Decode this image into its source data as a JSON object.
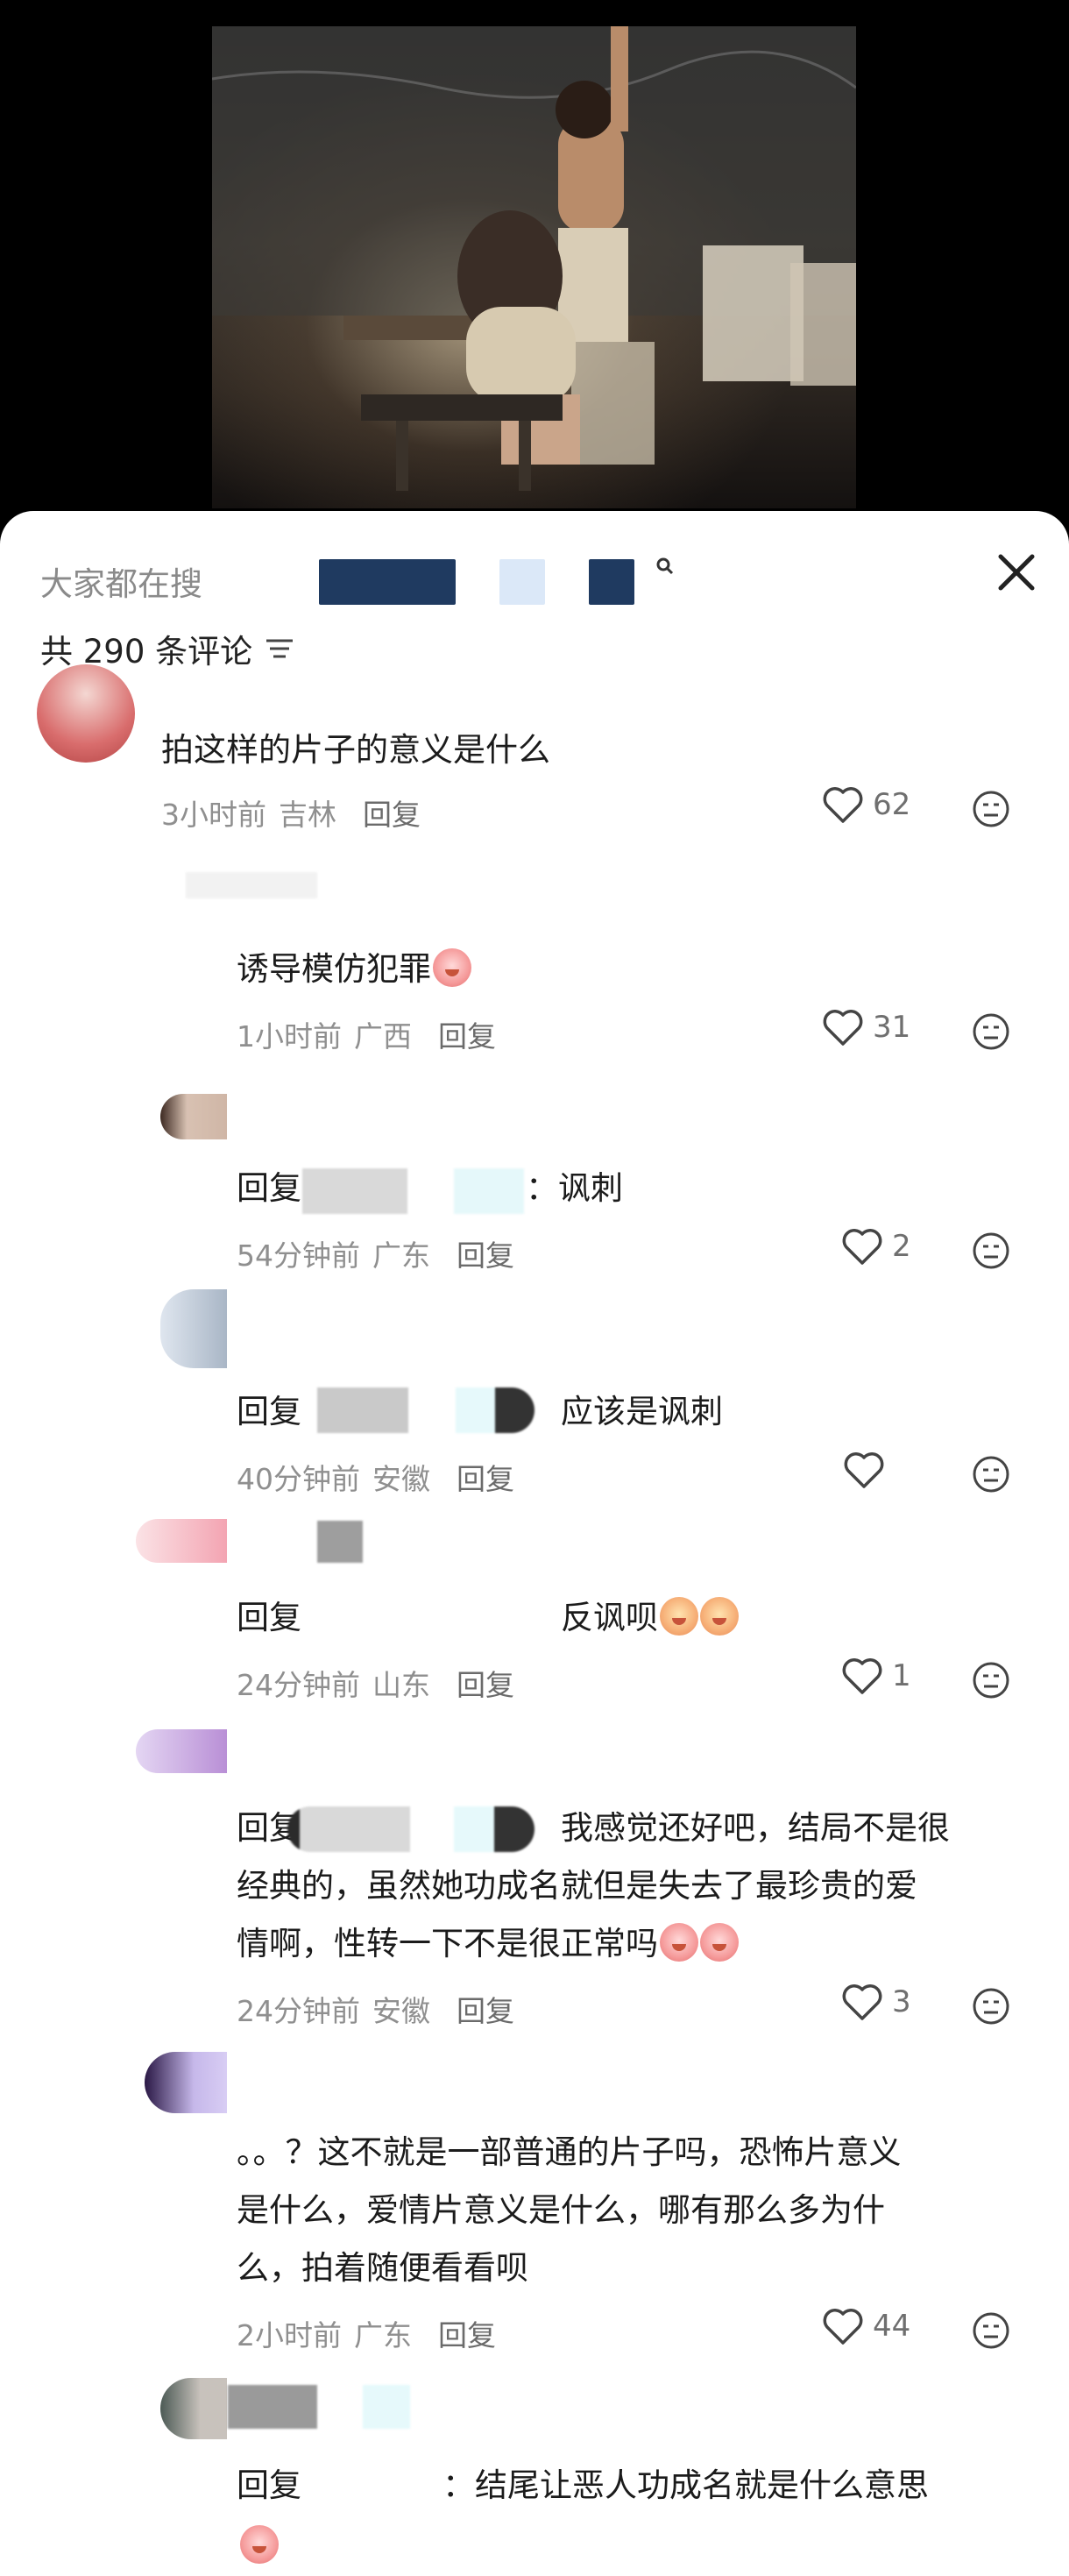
{
  "search": {
    "prefix": "大家都在搜"
  },
  "comments_header": {
    "count_label": "共 290 条评论"
  },
  "comments": [
    {
      "text": "拍这样的片子的意义是什么",
      "time": "3小时前",
      "location": "吉林",
      "reply": "回复",
      "likes": "62"
    },
    {
      "text": "诱导模仿犯罪",
      "time": "1小时前",
      "location": "广西",
      "reply": "回复",
      "likes": "31"
    },
    {
      "prefix": "回复",
      "text": "：讽刺",
      "time": "54分钟前",
      "location": "广东",
      "reply": "回复",
      "likes": "2"
    },
    {
      "prefix": "回复",
      "text": "应该是讽刺",
      "time": "40分钟前",
      "location": "安徽",
      "reply": "回复",
      "likes": ""
    },
    {
      "prefix": "回复",
      "text": "反讽呗",
      "time": "24分钟前",
      "location": "山东",
      "reply": "回复",
      "likes": "1"
    },
    {
      "prefix": "回复",
      "line1": "我感觉还好吧，结局不是很",
      "line2": "经典的，虽然她功成名就但是失去了最珍贵的爱",
      "line3": "情啊，性转一下不是很正常吗",
      "time": "24分钟前",
      "location": "安徽",
      "reply": "回复",
      "likes": "3"
    },
    {
      "line1": "。。？这不就是一部普通的片子吗，恐怖片意义",
      "line2": "是什么，爱情片意义是什么，哪有那么多为什",
      "line3": "么，拍着随便看看呗",
      "time": "2小时前",
      "location": "广东",
      "reply": "回复",
      "likes": "44"
    },
    {
      "prefix": "回复",
      "text": "：结尾让恶人功成名就是什么意思"
    }
  ]
}
